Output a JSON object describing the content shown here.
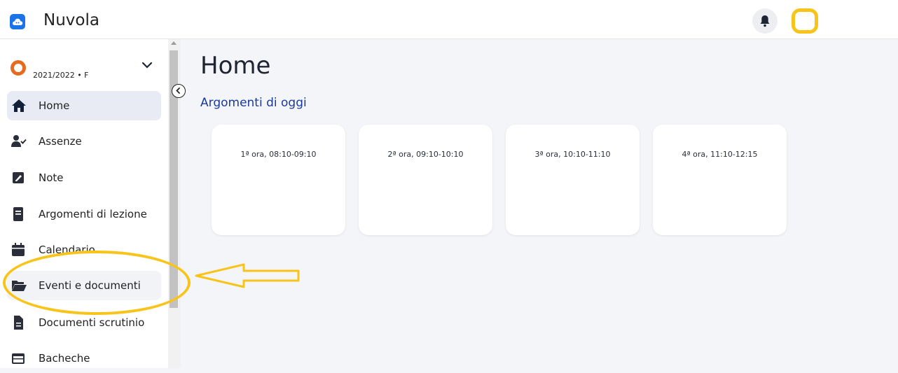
{
  "app": {
    "title": "Nuvola",
    "logo_icon": "cloud-icon",
    "brand_color": "#1a73e8"
  },
  "header": {
    "notification_icon": "bell-icon",
    "avatar_color": "#f8c41a"
  },
  "sidebar": {
    "school_year": "2021/2022 • F",
    "year_icon_color": "#e46b1f",
    "items": [
      {
        "label": "Home",
        "icon": "home-icon",
        "active": true
      },
      {
        "label": "Assenze",
        "icon": "user-check-icon"
      },
      {
        "label": "Note",
        "icon": "note-icon"
      },
      {
        "label": "Argomenti di lezione",
        "icon": "book-icon"
      },
      {
        "label": "Calendario",
        "icon": "calendar-icon"
      },
      {
        "label": "Eventi e documenti",
        "icon": "folder-open-icon",
        "highlighted": true
      },
      {
        "label": "Documenti scrutinio",
        "icon": "file-text-icon"
      },
      {
        "label": "Bacheche",
        "icon": "board-icon"
      }
    ]
  },
  "main": {
    "title": "Home",
    "section_title": "Argomenti di oggi",
    "accent_color": "#1a3a9c",
    "cards": [
      {
        "label": "1ª ora, 08:10-09:10"
      },
      {
        "label": "2ª ora, 09:10-10:10"
      },
      {
        "label": "3ª ora, 10:10-11:10"
      },
      {
        "label": "4ª ora, 11:10-12:15"
      }
    ]
  },
  "annotation": {
    "color": "#f8c41a"
  }
}
